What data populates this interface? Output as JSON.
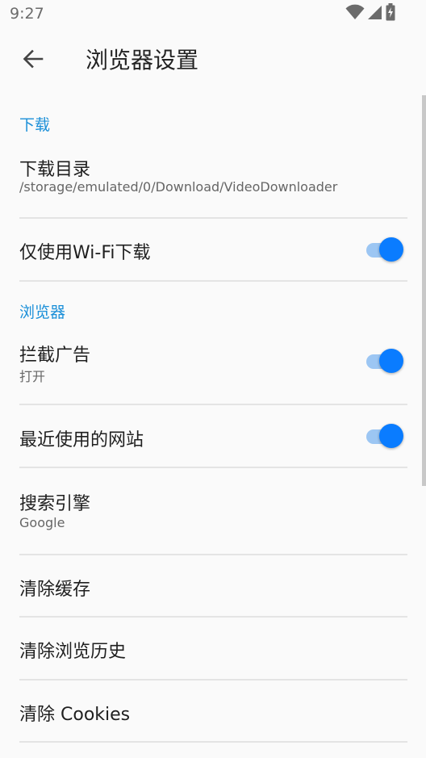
{
  "status_bar": {
    "time": "9:27",
    "icons": [
      "wifi-icon",
      "signal-icon",
      "battery-charging-icon"
    ]
  },
  "app_bar": {
    "back_icon": "arrow-back-icon",
    "title": "浏览器设置"
  },
  "sections": {
    "download": {
      "header": "下载",
      "download_directory": {
        "title": "下载目录",
        "summary": "/storage/emulated/0/Download/VideoDownloader"
      },
      "wifi_only": {
        "title": "仅使用Wi-Fi下载",
        "enabled": true
      }
    },
    "browser": {
      "header": "浏览器",
      "block_ads": {
        "title": "拦截广告",
        "summary": "打开",
        "enabled": true
      },
      "recent_sites": {
        "title": "最近使用的网站",
        "enabled": true
      },
      "search_engine": {
        "title": "搜索引擎",
        "summary": "Google"
      },
      "clear_cache": {
        "title": "清除缓存"
      },
      "clear_history": {
        "title": "清除浏览历史"
      },
      "clear_cookies": {
        "title": "清除 Cookies"
      }
    }
  },
  "colors": {
    "accent": "#1a8fd8",
    "switch_thumb": "#0a7cff",
    "switch_track": "#9cc6f3",
    "background": "#fafafa"
  }
}
